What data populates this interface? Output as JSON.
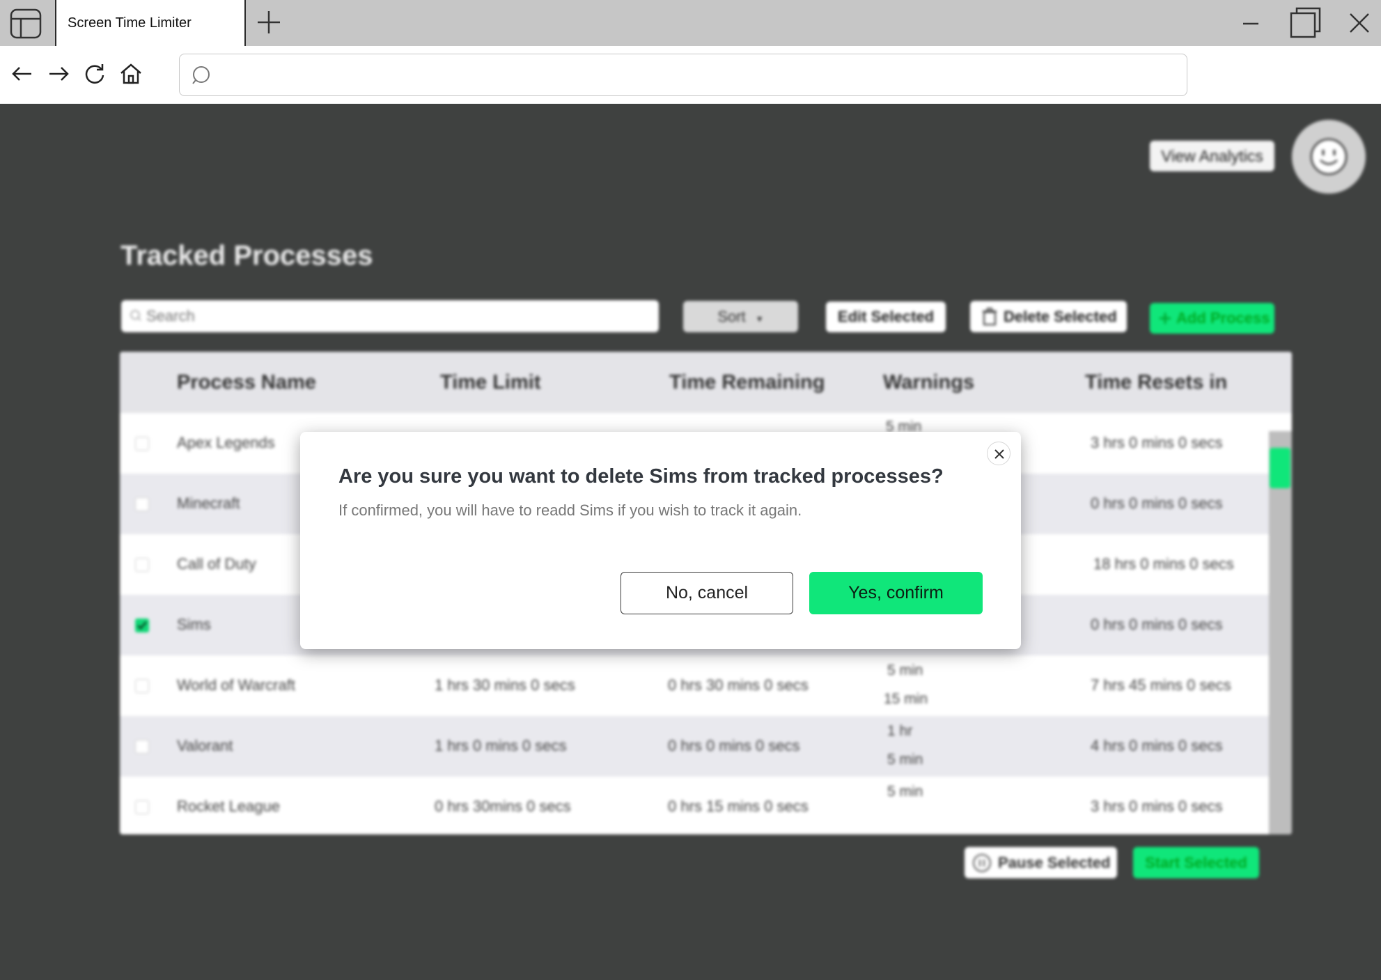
{
  "browser": {
    "tab_title": "Screen Time Limiter",
    "address_value": "",
    "icons": {
      "app_logo": "browser-window-icon",
      "new_tab": "plus-icon",
      "minimize": "minimize-icon",
      "maximize": "restore-icon",
      "close": "close-icon",
      "back": "arrow-left-icon",
      "forward": "arrow-right-icon",
      "reload": "reload-icon",
      "home": "home-icon",
      "search": "search-icon"
    }
  },
  "header": {
    "view_analytics_label": "View Analytics",
    "avatar_icon": "smiley-face-icon"
  },
  "page": {
    "title": "Tracked Processes"
  },
  "toolbar": {
    "search_placeholder": "Search",
    "sort_label": "Sort",
    "edit_label": "Edit Selected",
    "delete_label": "Delete Selected",
    "add_label": "Add Process"
  },
  "table": {
    "columns": [
      "Process Name",
      "Time Limit",
      "Time Remaining",
      "Warnings",
      "Time Resets in"
    ],
    "rows": [
      {
        "name": "Apex Legends",
        "checked": false,
        "limit": "",
        "remaining": "",
        "warnings": [
          "5 min"
        ],
        "resets": "3 hrs 0 mins 0 secs"
      },
      {
        "name": "Minecraft",
        "checked": false,
        "limit": "",
        "remaining": "",
        "warnings": [],
        "resets": "0 hrs 0 mins 0 secs"
      },
      {
        "name": "Call of Duty",
        "checked": false,
        "limit": "",
        "remaining": "",
        "warnings": [],
        "resets": "18 hrs 0 mins 0 secs"
      },
      {
        "name": "Sims",
        "checked": true,
        "limit": "",
        "remaining": "",
        "warnings": [],
        "resets": "0 hrs 0 mins 0 secs"
      },
      {
        "name": "World of Warcraft",
        "checked": false,
        "limit": "1 hrs 30 mins 0 secs",
        "remaining": "0 hrs 30 mins 0 secs",
        "warnings": [
          "5 min",
          "15 min"
        ],
        "resets": "7 hrs 45 mins 0 secs"
      },
      {
        "name": "Valorant",
        "checked": false,
        "limit": "1 hrs 0 mins 0 secs",
        "remaining": "0 hrs 0 mins 0 secs",
        "warnings": [
          "1 hr",
          "5 min"
        ],
        "resets": "4 hrs 0 mins 0 secs"
      },
      {
        "name": "Rocket League",
        "checked": false,
        "limit": "0 hrs 30mins 0 secs",
        "remaining": "0 hrs 15 mins 0 secs",
        "warnings": [
          "5 min"
        ],
        "resets": "3 hrs 0 mins 0 secs"
      }
    ]
  },
  "footer": {
    "pause_label": "Pause Selected",
    "start_label": "Start Selected"
  },
  "modal": {
    "title": "Are you sure you want to delete Sims from tracked processes?",
    "message": "If confirmed, you will have to readd Sims if you wish to track it again.",
    "cancel_label": "No, cancel",
    "confirm_label": "Yes, confirm"
  },
  "colors": {
    "background": "#3f4140",
    "accent": "#10e67a",
    "chrome": "#c6c6c6"
  }
}
